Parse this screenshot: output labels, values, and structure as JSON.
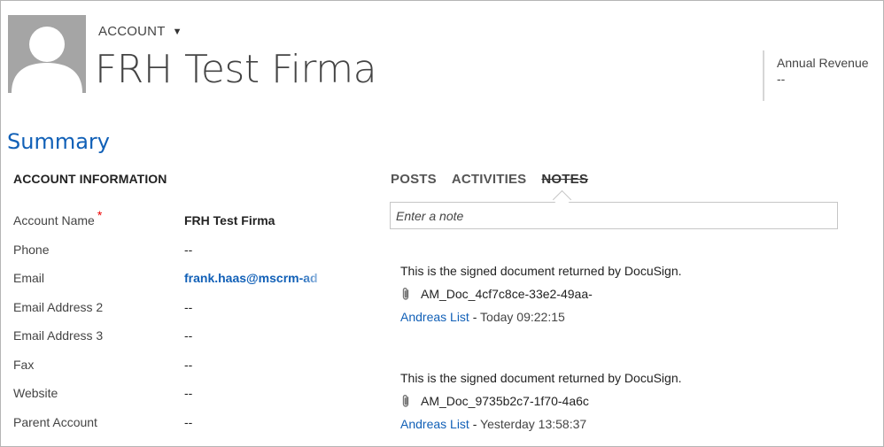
{
  "header": {
    "entity_type": "ACCOUNT",
    "title": "FRH Test Firma",
    "header_field": {
      "label": "Annual Revenue",
      "value": "--"
    }
  },
  "summary": {
    "title": "Summary",
    "section_title": "ACCOUNT INFORMATION",
    "fields": [
      {
        "label": "Account Name",
        "value": "FRH Test Firma",
        "required": "*"
      },
      {
        "label": "Phone",
        "value": "--"
      },
      {
        "label": "Email",
        "value": "frank.haas@mscrm-ad"
      },
      {
        "label": "Email Address 2",
        "value": "--"
      },
      {
        "label": "Email Address 3",
        "value": "--"
      },
      {
        "label": "Fax",
        "value": "--"
      },
      {
        "label": "Website",
        "value": "--"
      },
      {
        "label": "Parent Account",
        "value": "--"
      }
    ]
  },
  "social": {
    "tabs": [
      "POSTS",
      "ACTIVITIES",
      "NOTES"
    ],
    "active_tab": "NOTES",
    "note_placeholder": "Enter a note",
    "notes": [
      {
        "text": "This is the signed document returned by DocuSign.",
        "attachment": "AM_Doc_4cf7c8ce-33e2-49aa-",
        "author": "Andreas List",
        "separator": " - ",
        "time": "Today 09:22:15"
      },
      {
        "text": "This is the signed document returned by DocuSign.",
        "attachment": "AM_Doc_9735b2c7-1f70-4a6c",
        "author": "Andreas List",
        "separator": " - ",
        "time": "Yesterday 13:58:37"
      }
    ]
  },
  "colors": {
    "accent": "#1160b7",
    "required": "#ee0000",
    "avatar_bg": "#a5a5a5"
  }
}
